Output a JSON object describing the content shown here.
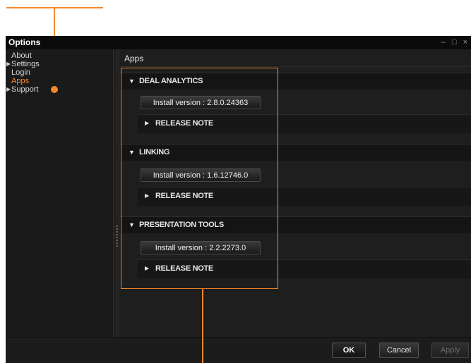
{
  "window": {
    "title": "Options",
    "controls": {
      "minimize": "–",
      "maximize": "□",
      "close": "×"
    }
  },
  "sidebar": {
    "items": [
      {
        "label": "About",
        "expandable": false,
        "active": false
      },
      {
        "label": "Settings",
        "expandable": true,
        "active": false
      },
      {
        "label": "Login",
        "expandable": false,
        "active": false
      },
      {
        "label": "Apps",
        "expandable": false,
        "active": true
      },
      {
        "label": "Support",
        "expandable": true,
        "active": false
      }
    ]
  },
  "content": {
    "title": "Apps",
    "sections": [
      {
        "name": "DEAL ANALYTICS",
        "install_label": "Install version : 2.8.0.24363",
        "release_note": "RELEASE NOTE"
      },
      {
        "name": "LINKING",
        "install_label": "Install version : 1.6.12746.0",
        "release_note": "RELEASE NOTE"
      },
      {
        "name": "PRESENTATION TOOLS",
        "install_label": "Install version : 2.2.2273.0",
        "release_note": "RELEASE NOTE"
      }
    ]
  },
  "footer": {
    "ok": "OK",
    "cancel": "Cancel",
    "apply": "Apply"
  },
  "colors": {
    "accent": "#f5882b",
    "background": "#1e1e1e",
    "titlebar": "#0b0b0b"
  },
  "icons": {
    "expand": "caret-right-icon",
    "section_expanded": "triangle-down-icon",
    "collapsed": "triangle-right-icon"
  }
}
